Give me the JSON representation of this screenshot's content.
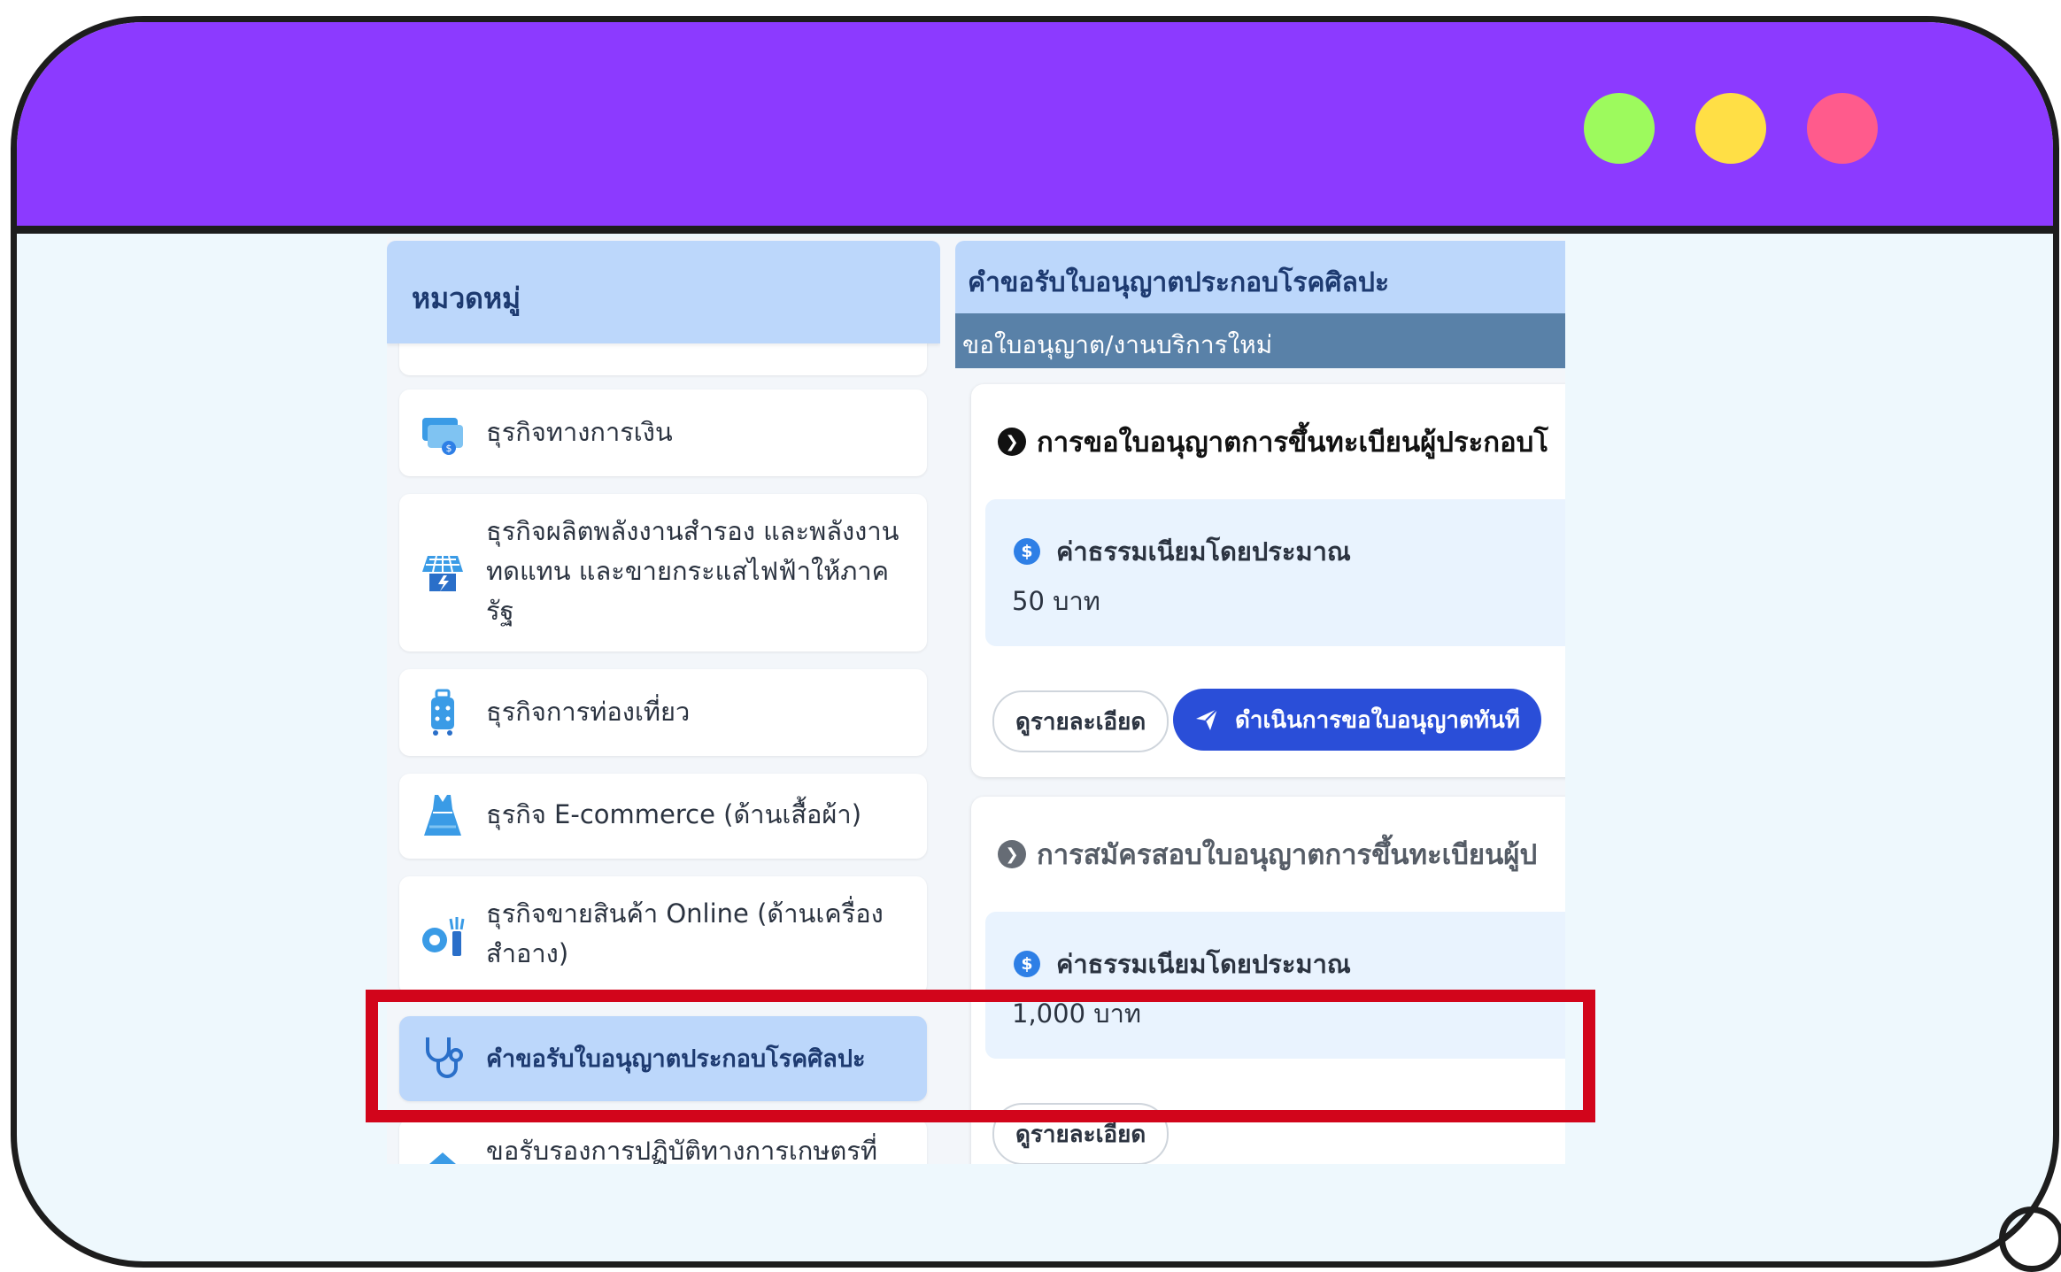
{
  "window": {
    "controls": [
      {
        "name": "green",
        "color": "#9dfa5d"
      },
      {
        "name": "yellow",
        "color": "#ffdf45"
      },
      {
        "name": "pink",
        "color": "#ff5b8c"
      }
    ],
    "accent_color": "#8c3aff"
  },
  "categories": {
    "header": "หมวดหมู่",
    "items": [
      {
        "label": "ธุรกิจทางการเงิน",
        "icon": "money-card-icon"
      },
      {
        "label": "ธุรกิจผลิตพลังงานสำรอง และพลังงานทดแทน และขายกระแสไฟฟ้าให้ภาครัฐ",
        "icon": "solar-panel-icon"
      },
      {
        "label": "ธุรกิจการท่องเที่ยว",
        "icon": "luggage-icon"
      },
      {
        "label": "ธุรกิจ E-commerce (ด้านเสื้อผ้า)",
        "icon": "dress-icon"
      },
      {
        "label": "ธุรกิจขายสินค้า Online (ด้านเครื่องสำอาง)",
        "icon": "cosmetics-icon"
      },
      {
        "label": "คำขอรับใบอนุญาตประกอบโรคศิลปะ",
        "icon": "stethoscope-icon",
        "active": true
      },
      {
        "label": "ขอรับรองการปฏิบัติทางการเกษตรที่",
        "icon": "farm-icon"
      }
    ]
  },
  "detail": {
    "title": "คำขอรับใบอนุญาตประกอบโรคศิลปะ",
    "subheader": "ขอใบอนุญาต/งานบริการใหม่",
    "cards": [
      {
        "title": "การขอใบอนุญาตการขึ้นทะเบียนผู้ประกอบโ",
        "fee_label": "ค่าธรรมเนียมโดยประมาณ",
        "fee_value": "50 บาท",
        "details_button": "ดูรายละเอียด",
        "action_button": "ดำเนินการขอใบอนุญาตทันที"
      },
      {
        "title": "การสมัครสอบใบอนุญาตการขึ้นทะเบียนผู้ป",
        "fee_label": "ค่าธรรมเนียมโดยประมาณ",
        "fee_value": "1,000 บาท",
        "details_button": "ดูรายละเอียด"
      }
    ]
  },
  "highlight_color": "#d2051b"
}
